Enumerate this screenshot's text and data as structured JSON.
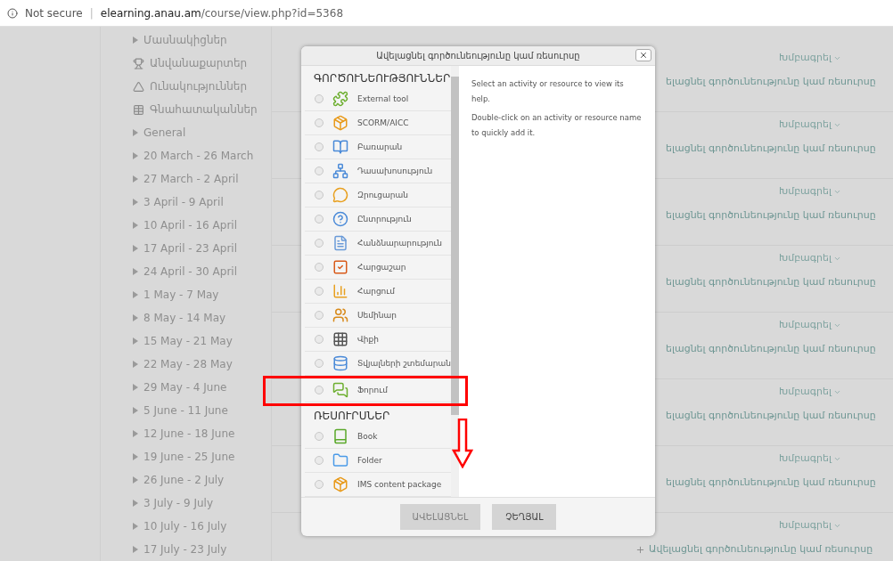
{
  "browser": {
    "security": "Not secure",
    "separator": "|",
    "host": "elearning.anau.am",
    "path": "/course/view.php?id=5368"
  },
  "sidebar": {
    "items": [
      {
        "kind": "caret",
        "label": "Մասնակիցներ"
      },
      {
        "kind": "trophy",
        "label": "Անվանաքարտեր"
      },
      {
        "kind": "competency",
        "label": "Ունակություններ"
      },
      {
        "kind": "grades",
        "label": "Գնահատականներ"
      },
      {
        "kind": "caret",
        "label": "General"
      },
      {
        "kind": "caret",
        "label": "20 March - 26 March"
      },
      {
        "kind": "caret",
        "label": "27 March - 2 April"
      },
      {
        "kind": "caret",
        "label": "3 April - 9 April"
      },
      {
        "kind": "caret",
        "label": "10 April - 16 April"
      },
      {
        "kind": "caret",
        "label": "17 April - 23 April"
      },
      {
        "kind": "caret",
        "label": "24 April - 30 April"
      },
      {
        "kind": "caret",
        "label": "1 May - 7 May"
      },
      {
        "kind": "caret",
        "label": "8 May - 14 May"
      },
      {
        "kind": "caret",
        "label": "15 May - 21 May"
      },
      {
        "kind": "caret",
        "label": "22 May - 28 May"
      },
      {
        "kind": "caret",
        "label": "29 May - 4 June"
      },
      {
        "kind": "caret",
        "label": "5 June - 11 June"
      },
      {
        "kind": "caret",
        "label": "12 June - 18 June"
      },
      {
        "kind": "caret",
        "label": "19 June - 25 June"
      },
      {
        "kind": "caret",
        "label": "26 June - 2 July"
      },
      {
        "kind": "caret",
        "label": "3 July - 9 July"
      },
      {
        "kind": "caret",
        "label": "10 July - 16 July"
      },
      {
        "kind": "caret",
        "label": "17 July - 23 July"
      }
    ]
  },
  "sections": [
    {
      "edit": "Խմբագրել",
      "add": "ելացնել գործունեությունը կամ ռեսուրսը"
    },
    {
      "edit": "Խմբագրել",
      "add": "ելացնել գործունեությունը կամ ռեսուրսը"
    },
    {
      "edit": "Խմբագրել",
      "add": "ելացնել գործունեությունը կամ ռեսուրսը"
    },
    {
      "edit": "Խմբագրել",
      "add": "ելացնել գործունեությունը կամ ռեսուրսը"
    },
    {
      "edit": "Խմբագրել",
      "add": "ելացնել գործունեությունը կամ ռեսուրսը"
    },
    {
      "edit": "Խմբագրել",
      "add": "ելացնել գործունեությունը կամ ռեսուրսը"
    },
    {
      "edit": "Խմբագրել",
      "add": "ելացնել գործունեությունը կամ ռեսուրսը"
    },
    {
      "edit": "Խմբագրել",
      "add": "Ավելացնել գործունեությունը կամ ռեսուրսը"
    }
  ],
  "dialog": {
    "title": "Ավելացնել գործունեությունը կամ ռեսուրսը",
    "groups": [
      {
        "heading": "ԳՈՐԾՈՒՆԵՈՒԹՅՈՒՆՆԵՐ",
        "items": [
          {
            "label": "External tool",
            "selected": false
          },
          {
            "label": "SCORM/AICC",
            "selected": false
          },
          {
            "label": "Բառարան",
            "selected": false
          },
          {
            "label": "Դասախոսություն",
            "selected": false
          },
          {
            "label": "Զրուցարան",
            "selected": false
          },
          {
            "label": "Ընտրություն",
            "selected": false
          },
          {
            "label": "Հանձնարարություն",
            "selected": false
          },
          {
            "label": "Հարցաշար",
            "selected": false
          },
          {
            "label": "Հարցում",
            "selected": false
          },
          {
            "label": "Սեմինար",
            "selected": false
          },
          {
            "label": "Վիքի",
            "selected": false
          },
          {
            "label": "Տվյալների շտեմարան",
            "selected": false
          },
          {
            "label": "Ֆորում",
            "selected": false
          }
        ]
      },
      {
        "heading": "ՌԵՍՈՒՐՍՆԵՐ",
        "items": [
          {
            "label": "Book",
            "selected": false
          },
          {
            "label": "Folder",
            "selected": false
          },
          {
            "label": "IMS content package",
            "selected": false
          }
        ]
      }
    ],
    "help": [
      "Select an activity or resource to view its help.",
      "Double-click on an activity or resource name to quickly add it."
    ],
    "buttons": [
      {
        "label": "ԱՎԵԼԱՑՆԵԼ",
        "disabled": true
      },
      {
        "label": "ՉԵՂՅԱԼ",
        "disabled": false
      }
    ]
  }
}
